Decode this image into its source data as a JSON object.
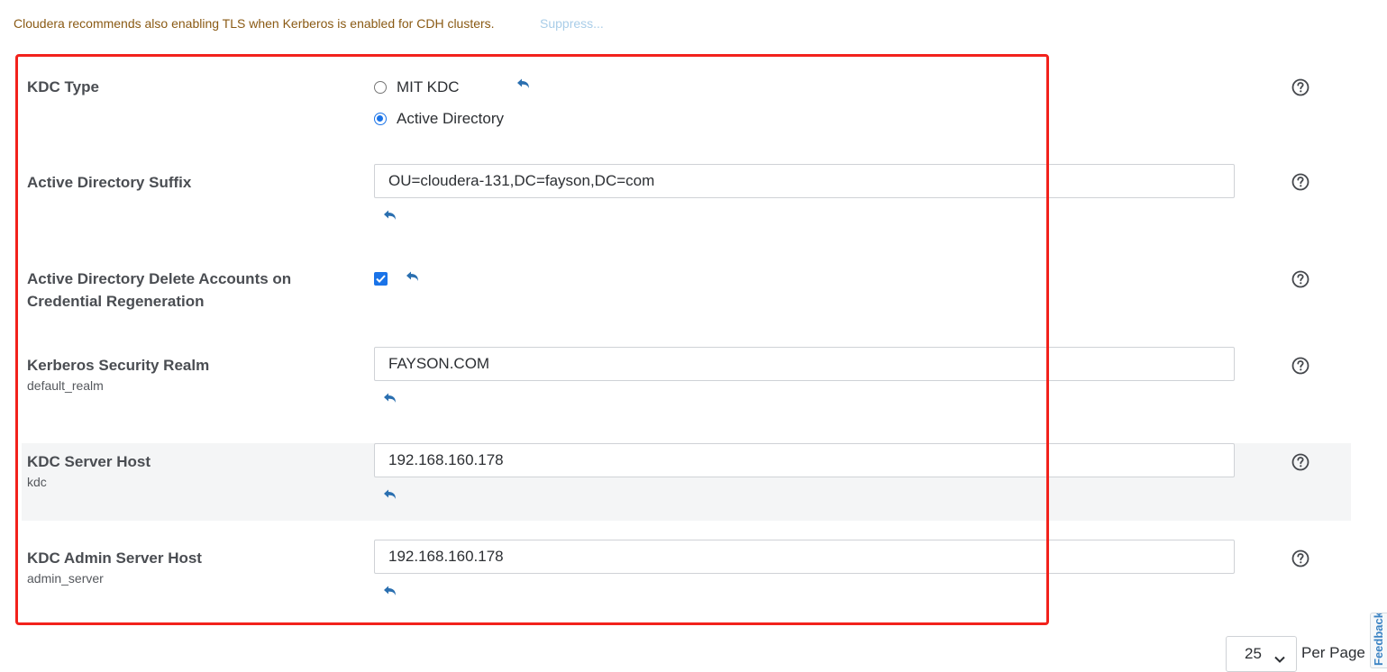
{
  "notice": {
    "text": "Cloudera recommends also enabling TLS when Kerberos is enabled for CDH clusters.",
    "suppress_label": "Suppress..."
  },
  "fields": {
    "kdc_type": {
      "label": "KDC Type",
      "options": [
        "MIT KDC",
        "Active Directory"
      ],
      "selected": "Active Directory"
    },
    "ad_suffix": {
      "label": "Active Directory Suffix",
      "value": "OU=cloudera-131,DC=fayson,DC=com"
    },
    "ad_delete_accounts": {
      "label": "Active Directory Delete Accounts on Credential Regeneration",
      "checked": true
    },
    "security_realm": {
      "label": "Kerberos Security Realm",
      "key": "default_realm",
      "value": "FAYSON.COM"
    },
    "kdc_server_host": {
      "label": "KDC Server Host",
      "key": "kdc",
      "value": "192.168.160.178"
    },
    "kdc_admin_server_host": {
      "label": "KDC Admin Server Host",
      "key": "admin_server",
      "value": "192.168.160.178"
    }
  },
  "pagination": {
    "per_page_value": "25",
    "per_page_label": "Per Page"
  },
  "feedback_tab": {
    "label": "Feedback"
  },
  "colors": {
    "accent": "#1a73e8",
    "undo_icon": "#2a6fb0",
    "highlight_border": "#f2221c",
    "notice_text": "#8a5a14"
  },
  "icons": [
    "undo-icon",
    "help-icon",
    "chevron-down-icon"
  ]
}
